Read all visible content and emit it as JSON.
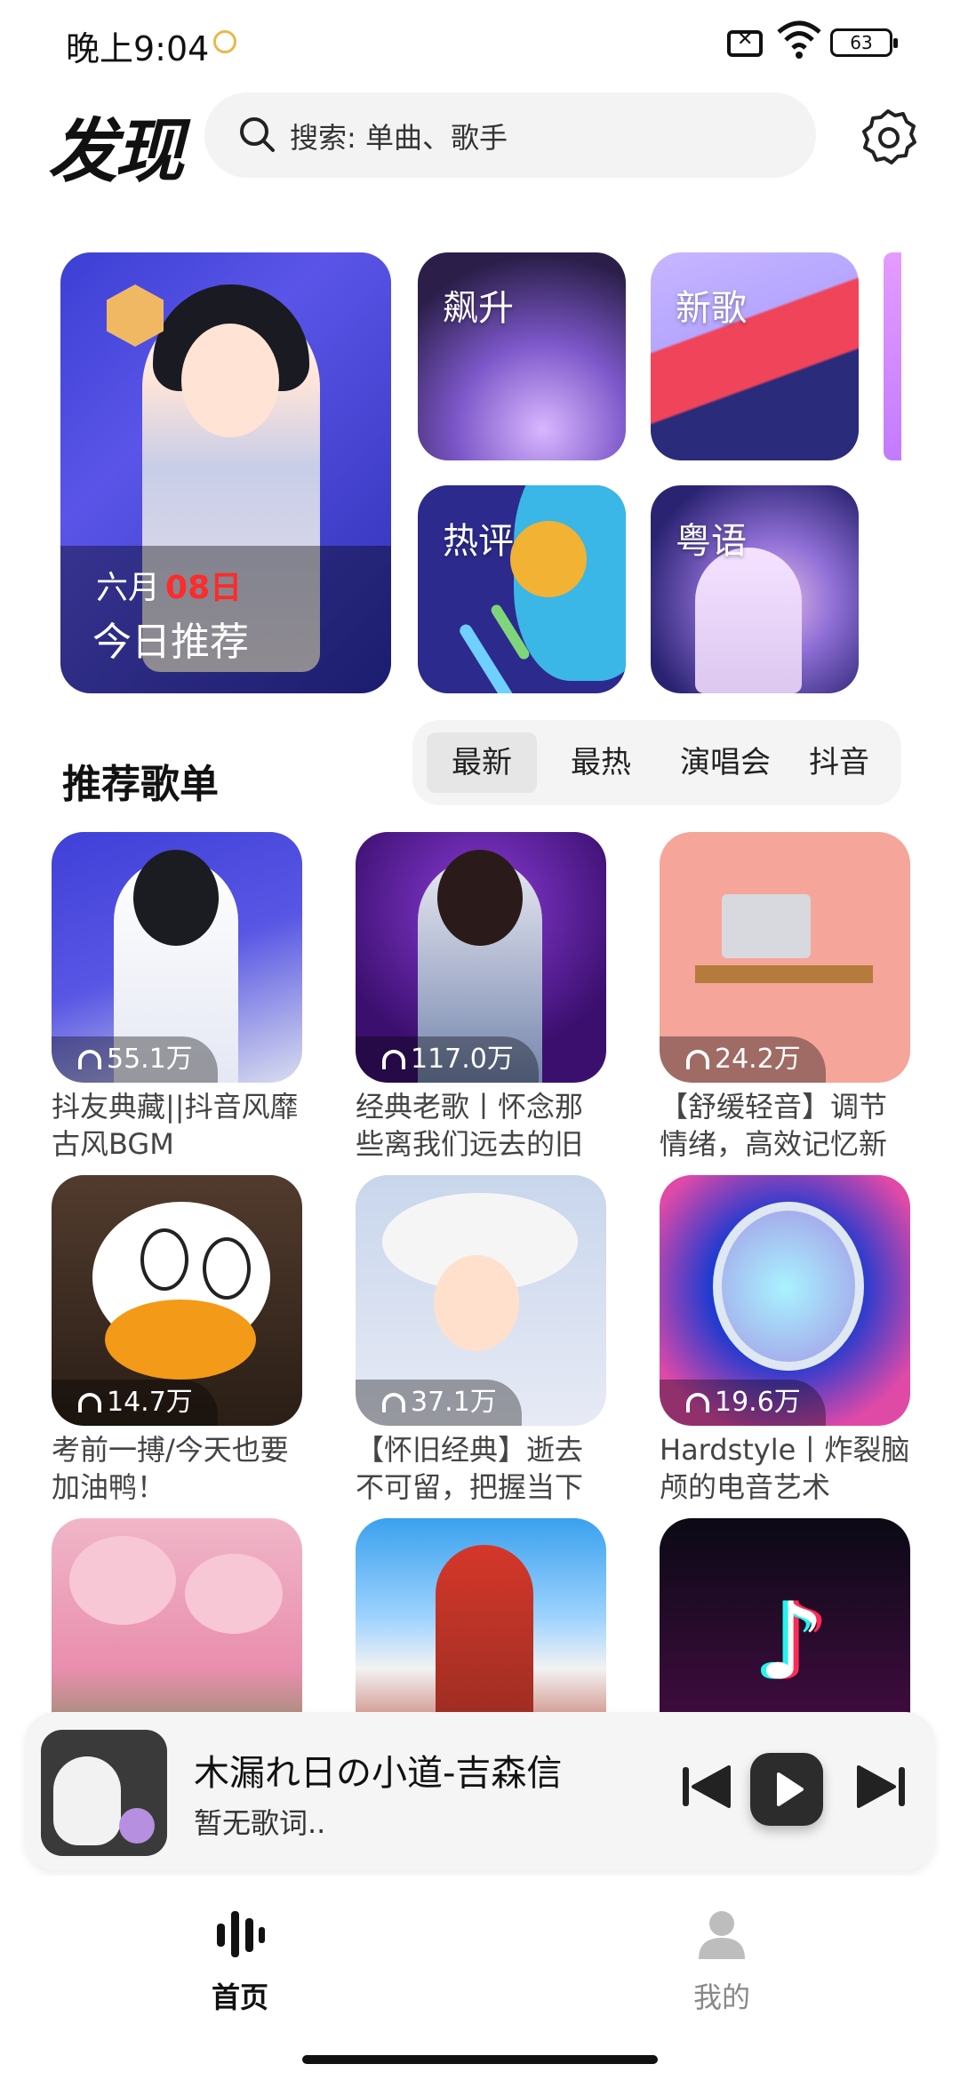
{
  "status_bar": {
    "time": "晚上9:04",
    "battery": "63"
  },
  "header": {
    "title": "发现",
    "search_placeholder": "搜索: 单曲、歌手"
  },
  "featured": {
    "hero": {
      "month": "六月",
      "day": "08日",
      "label": "今日推荐"
    },
    "tiles": [
      "飙升",
      "新歌",
      "热评",
      "粤语"
    ]
  },
  "playlists_section": {
    "title": "推荐歌单",
    "tabs": [
      "最新",
      "最热",
      "演唱会",
      "抖音"
    ],
    "active_tab": "最新",
    "items": [
      {
        "plays": "55.1万",
        "name": "抖友典藏||抖音风靡古风BGM"
      },
      {
        "plays": "117.0万",
        "name": "经典老歌丨怀念那些离我们远去的旧"
      },
      {
        "plays": "24.2万",
        "name": "【舒缓轻音】调节情绪，高效记忆新"
      },
      {
        "plays": "14.7万",
        "name": "考前一搏/今天也要加油鸭！"
      },
      {
        "plays": "37.1万",
        "name": "【怀旧经典】逝去不可留，把握当下"
      },
      {
        "plays": "19.6万",
        "name": "Hardstyle丨炸裂脑颅的电音艺术"
      },
      {
        "plays": "",
        "name": ""
      },
      {
        "plays": "",
        "name": ""
      },
      {
        "plays": "",
        "name": ""
      }
    ]
  },
  "player": {
    "song": "木漏れ日の小道-吉森信",
    "lyric": "暂无歌词.."
  },
  "nav": {
    "home": "首页",
    "mine": "我的"
  },
  "colors": {
    "accent_red": "#ff2a2a",
    "dark": "#2c2c2c"
  }
}
